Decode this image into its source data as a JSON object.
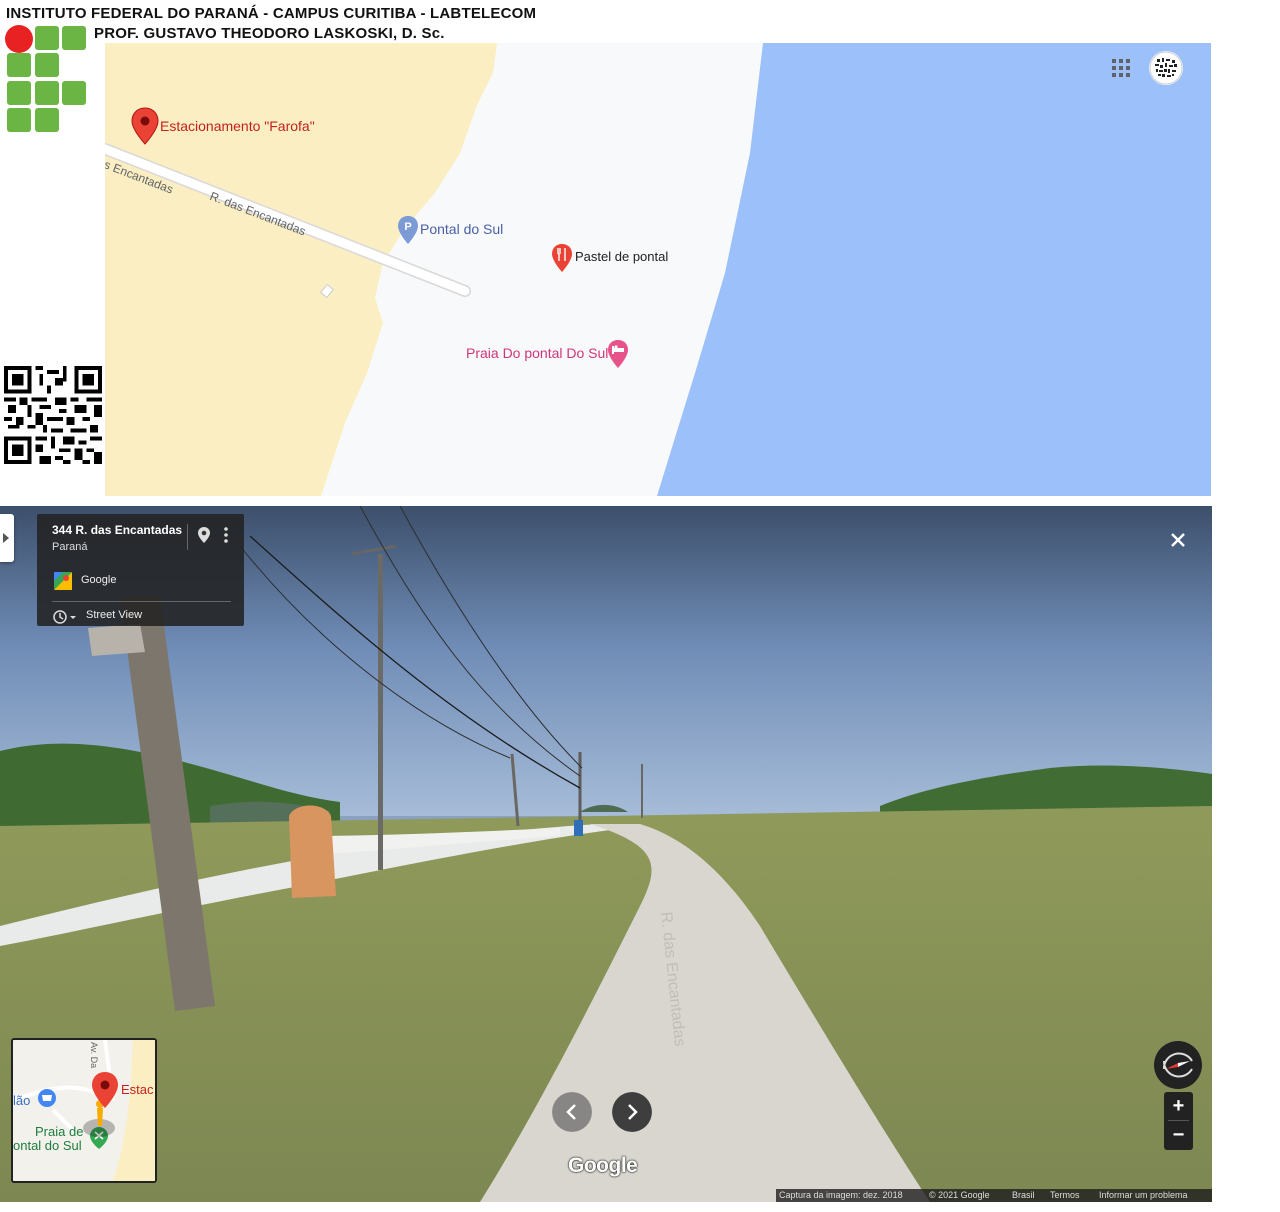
{
  "header": {
    "line1": "INSTITUTO FEDERAL DO PARANÁ - CAMPUS CURITIBA - LABTELECOM",
    "line2": "PROF. GUSTAVO THEODORO LASKOSKI, D. Sc."
  },
  "map": {
    "road_label_1": "as Encantadas",
    "road_label_2": "R. das Encantadas",
    "places": {
      "parking": "Estacionamento \"Farofa\"",
      "pontal": "Pontal do Sul",
      "pastel": "Pastel de pontal",
      "praia": "Praia Do pontal Do Sul"
    },
    "colors": {
      "sand": "#fbeec2",
      "sea": "#9cc0f9",
      "beach": "#f8f9fa",
      "red_pin": "#ea4335",
      "parking_pin": "#7b9ad6",
      "hotel_pin": "#e8528b"
    },
    "icons": [
      "apps-grid-icon",
      "account-avatar-icon"
    ]
  },
  "streetview": {
    "address": "344 R. das Encantadas",
    "state": "Paraná",
    "provider": "Google",
    "mode": "Street View",
    "road_text": "R. das Encantadas",
    "watermark": "Google",
    "minimap": {
      "label_left": "lão",
      "label_beach_1": "Praia de",
      "label_beach_2": "ontal do Sul",
      "label_right": "Estac",
      "label_road": "Av. Da"
    },
    "zoom_in": "+",
    "zoom_out": "−",
    "footer": {
      "capture": "Captura da imagem: dez. 2018",
      "copyright": "© 2021 Google",
      "country": "Brasil",
      "terms": "Termos",
      "report": "Informar um problema"
    }
  }
}
